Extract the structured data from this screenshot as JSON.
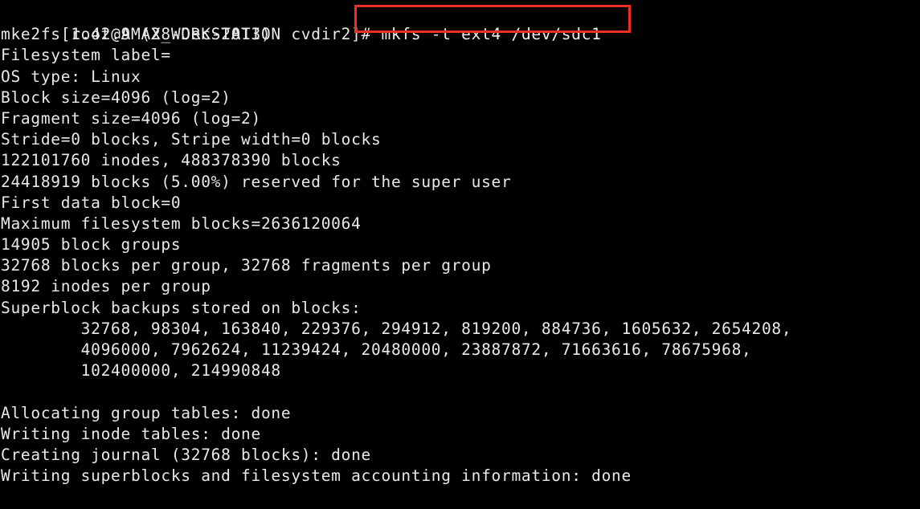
{
  "terminal": {
    "background_color": "#000000",
    "text_color": "#e9e9e9",
    "highlight_color": "#ee2f24",
    "prompt": "[root@AMAX_WORKSTATION cvdir2]#",
    "command": "mkfs -t ext4 /dev/sdc1",
    "output_lines": [
      "mke2fs 1.42.9 (28-Dec-2013)",
      "Filesystem label=",
      "OS type: Linux",
      "Block size=4096 (log=2)",
      "Fragment size=4096 (log=2)",
      "Stride=0 blocks, Stripe width=0 blocks",
      "122101760 inodes, 488378390 blocks",
      "24418919 blocks (5.00%) reserved for the super user",
      "First data block=0",
      "Maximum filesystem blocks=2636120064",
      "14905 block groups",
      "32768 blocks per group, 32768 fragments per group",
      "8192 inodes per group",
      "Superblock backups stored on blocks:",
      "        32768, 98304, 163840, 229376, 294912, 819200, 884736, 1605632, 2654208,",
      "        4096000, 7962624, 11239424, 20480000, 23887872, 71663616, 78675968,",
      "        102400000, 214990848",
      "",
      "Allocating group tables: done",
      "Writing inode tables: done",
      "Creating journal (32768 blocks): done",
      "Writing superblocks and filesystem accounting information: done"
    ],
    "filesystem_details": {
      "mke2fs_version": "1.42.9",
      "mke2fs_date": "28-Dec-2013",
      "filesystem_label": "",
      "os_type": "Linux",
      "block_size": "4096",
      "block_size_log": "2",
      "fragment_size": "4096",
      "fragment_size_log": "2",
      "stride": "0",
      "stripe_width": "0",
      "inodes": "122101760",
      "blocks": "488378390",
      "reserved_blocks": "24418919",
      "reserved_percent": "5.00%",
      "first_data_block": "0",
      "maximum_filesystem_blocks": "2636120064",
      "block_groups": "14905",
      "blocks_per_group": "32768",
      "fragments_per_group": "32768",
      "inodes_per_group": "8192",
      "journal_blocks": "32768",
      "superblock_backups": [
        "32768",
        "98304",
        "163840",
        "229376",
        "294912",
        "819200",
        "884736",
        "1605632",
        "2654208",
        "4096000",
        "7962624",
        "11239424",
        "20480000",
        "23887872",
        "71663616",
        "78675968",
        "102400000",
        "214990848"
      ],
      "status_allocating_group_tables": "done",
      "status_writing_inode_tables": "done",
      "status_creating_journal": "done",
      "status_writing_superblocks": "done"
    }
  }
}
